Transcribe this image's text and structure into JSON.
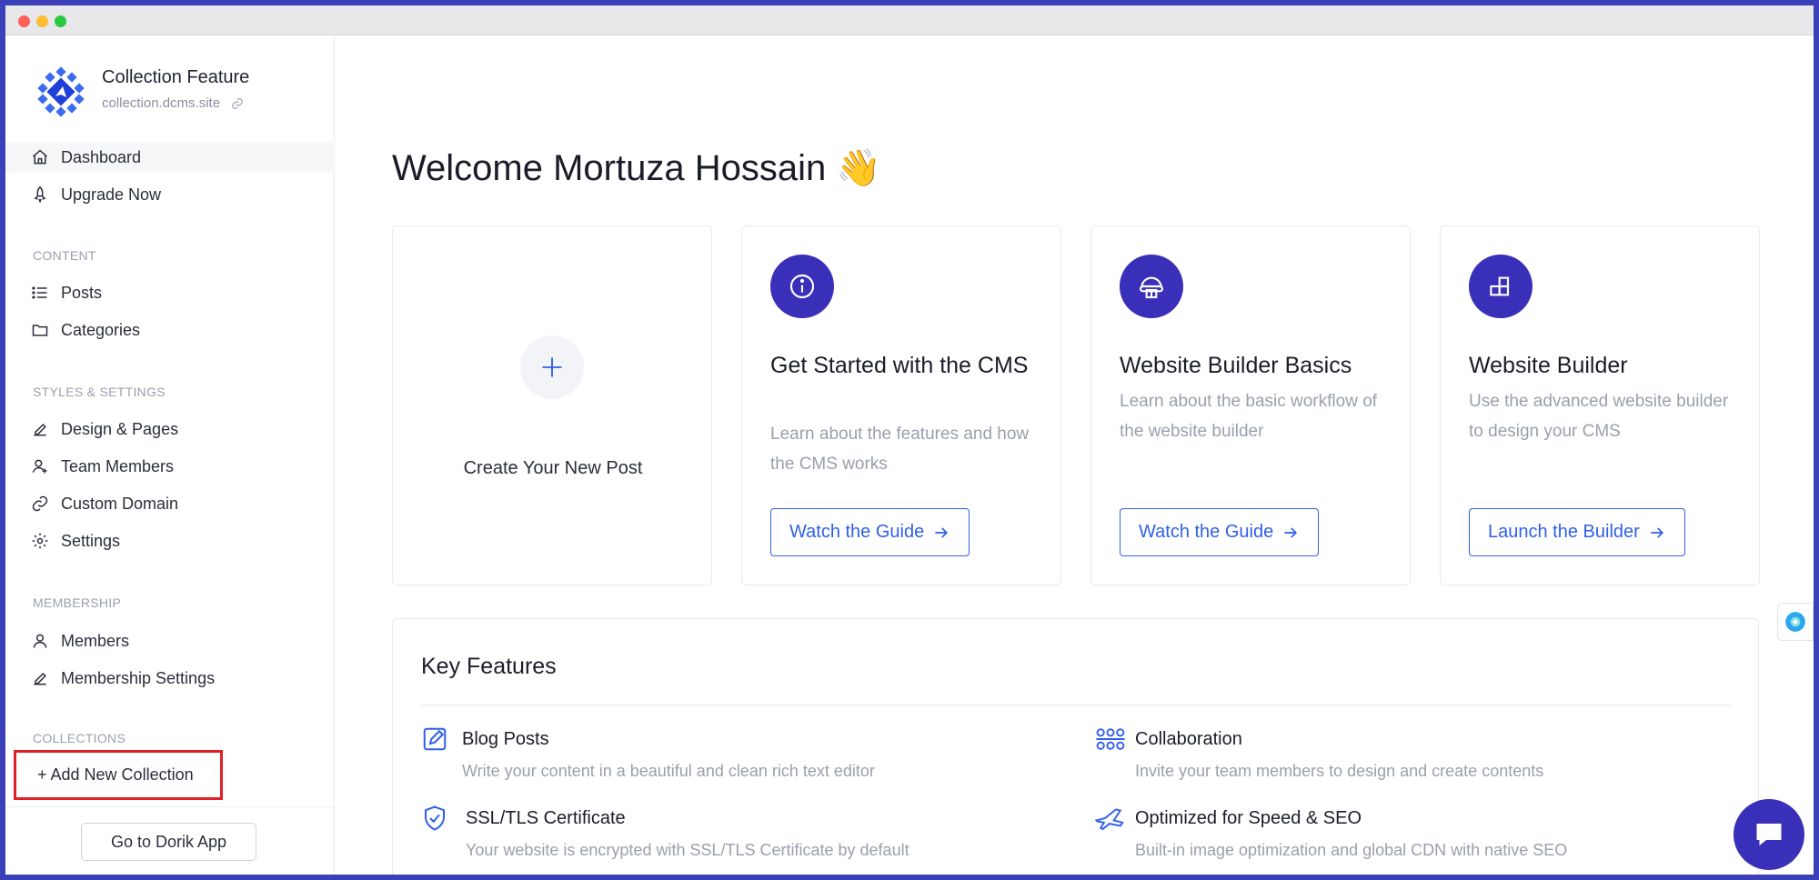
{
  "site": {
    "title": "Collection Feature",
    "url": "collection.dcms.site"
  },
  "nav": {
    "dashboard": "Dashboard",
    "upgrade": "Upgrade Now",
    "content_label": "CONTENT",
    "posts": "Posts",
    "categories": "Categories",
    "styles_label": "STYLES & SETTINGS",
    "design": "Design & Pages",
    "team": "Team Members",
    "domain": "Custom Domain",
    "settings": "Settings",
    "membership_label": "MEMBERSHIP",
    "members": "Members",
    "membership_settings": "Membership Settings",
    "collections_label": "COLLECTIONS",
    "add_collection": "+ Add New Collection",
    "dorik_app": "Go to Dorik App"
  },
  "main": {
    "welcome": "Welcome Mortuza Hossain",
    "welcome_emoji": "👋",
    "create_post": "Create Your New Post",
    "cards": [
      {
        "title": "Get Started with the CMS",
        "desc": "Learn about the features and how the CMS works",
        "button": "Watch the Guide",
        "icon": "info-icon"
      },
      {
        "title": "Website Builder Basics",
        "desc": "Learn about the basic workflow of the website builder",
        "button": "Watch the Guide",
        "icon": "builder-basics-icon"
      },
      {
        "title": "Website Builder",
        "desc": "Use the advanced website builder to design your CMS",
        "button": "Launch the Builder",
        "icon": "blocks-icon"
      }
    ]
  },
  "features": {
    "title": "Key Features",
    "items": [
      {
        "title": "Blog Posts",
        "desc": "Write your content in a beautiful and clean rich text editor"
      },
      {
        "title": "Collaboration",
        "desc": "Invite your team members to design and create contents"
      },
      {
        "title": "SSL/TLS Certificate",
        "desc": "Your website is encrypted with SSL/TLS Certificate by default"
      },
      {
        "title": "Optimized for Speed & SEO",
        "desc": "Built-in image optimization and global CDN with native SEO"
      }
    ]
  },
  "colors": {
    "accent": "#3a2fb8",
    "link_blue": "#2f5fea",
    "highlight_red": "#e01f26"
  }
}
